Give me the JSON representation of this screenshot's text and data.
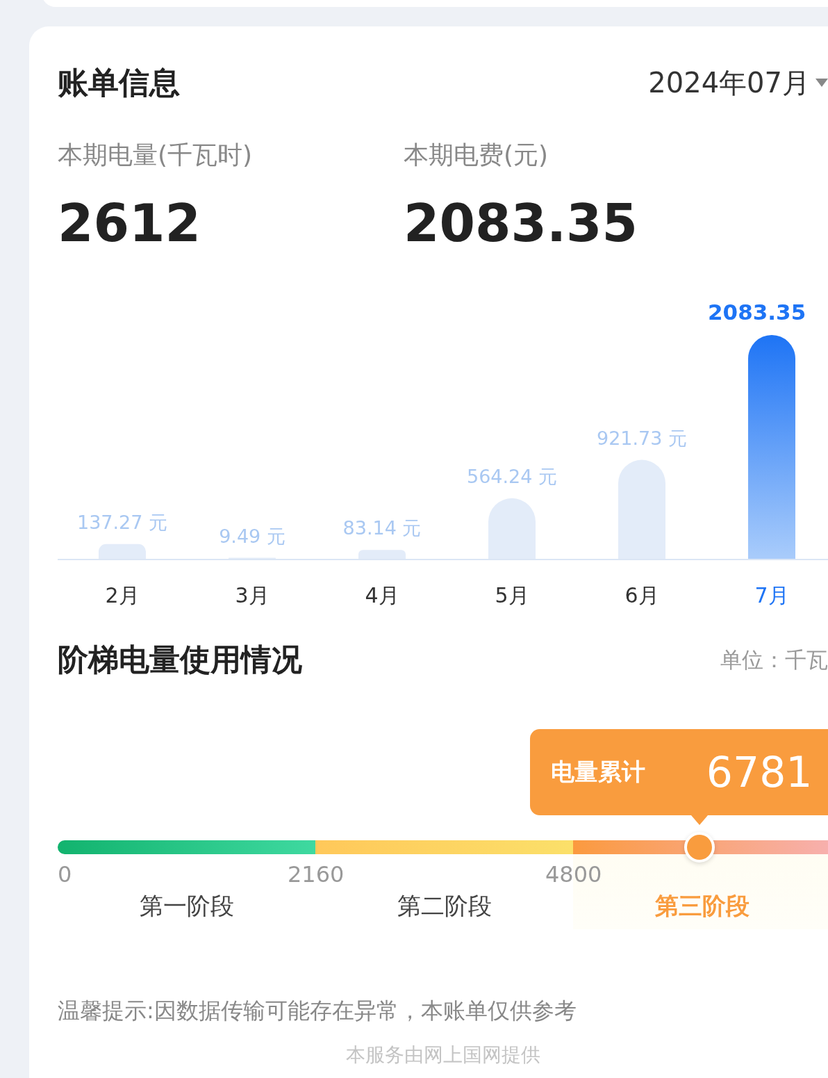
{
  "bill": {
    "title": "账单信息",
    "period": "2024年07月",
    "stats": [
      {
        "label": "本期电量(千瓦时)",
        "value": "2612"
      },
      {
        "label": "本期电费(元)",
        "value": "2083.35"
      }
    ],
    "chart_data": {
      "type": "bar",
      "categories": [
        "2月",
        "3月",
        "4月",
        "5月",
        "6月",
        "7月"
      ],
      "values": [
        137.27,
        9.49,
        83.14,
        564.24,
        921.73,
        2083.35
      ],
      "data_labels": "value_labels",
      "value_labels": [
        "137.27 元",
        "9.49 元",
        "83.14 元",
        "564.24 元",
        "921.73 元",
        "2083.35"
      ]
    },
    "bar_states": [
      {
        "selected": false
      },
      {
        "selected": false
      },
      {
        "selected": false
      },
      {
        "selected": false
      },
      {
        "selected": false
      },
      {
        "selected": true
      }
    ]
  },
  "tiers": {
    "title": "阶梯电量使用情况",
    "unit": "单位：千瓦",
    "total": {
      "label": "电量累计",
      "value": "6781",
      "level": 0.83
    },
    "stages": [
      {
        "start": "0",
        "label": "第一阶段",
        "selected": false
      },
      {
        "start": "2160",
        "label": "第二阶段",
        "selected": false
      },
      {
        "start": "4800",
        "label": "第三阶段",
        "selected": true
      }
    ]
  },
  "tip": "温馨提示:因数据传输可能存在异常，本账单仅供参考",
  "footer": "本服务由网上国网提供"
}
